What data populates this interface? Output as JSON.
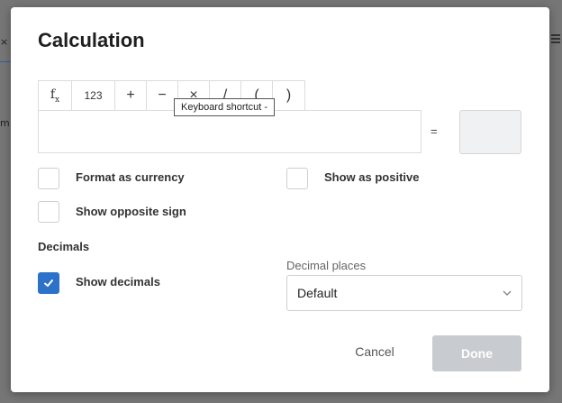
{
  "background": {
    "fragment_x": "×",
    "fragment_m": "m"
  },
  "dialog": {
    "title": "Calculation",
    "toolbar": [
      {
        "name": "fx",
        "label": "f",
        "sub": "x"
      },
      {
        "name": "number",
        "label": "123"
      },
      {
        "name": "plus",
        "label": "+"
      },
      {
        "name": "minus",
        "label": "−"
      },
      {
        "name": "multiply",
        "label": "×"
      },
      {
        "name": "divide",
        "label": "/"
      },
      {
        "name": "open-paren",
        "label": "("
      },
      {
        "name": "close-paren",
        "label": ")"
      }
    ],
    "tooltip": "Keyboard shortcut -",
    "expression_value": "",
    "equals_sign": "=",
    "result_value": "",
    "options": {
      "format_currency": {
        "label": "Format as currency",
        "checked": false
      },
      "show_positive": {
        "label": "Show as positive",
        "checked": false
      },
      "opposite_sign": {
        "label": "Show opposite sign",
        "checked": false
      }
    },
    "decimals": {
      "section_title": "Decimals",
      "show_decimals": {
        "label": "Show decimals",
        "checked": true
      },
      "places_label": "Decimal places",
      "places_value": "Default"
    },
    "buttons": {
      "cancel": "Cancel",
      "done": "Done"
    }
  },
  "colors": {
    "accent": "#2c72c9",
    "done_disabled": "#c8ccd0",
    "overlay": "#767676"
  }
}
